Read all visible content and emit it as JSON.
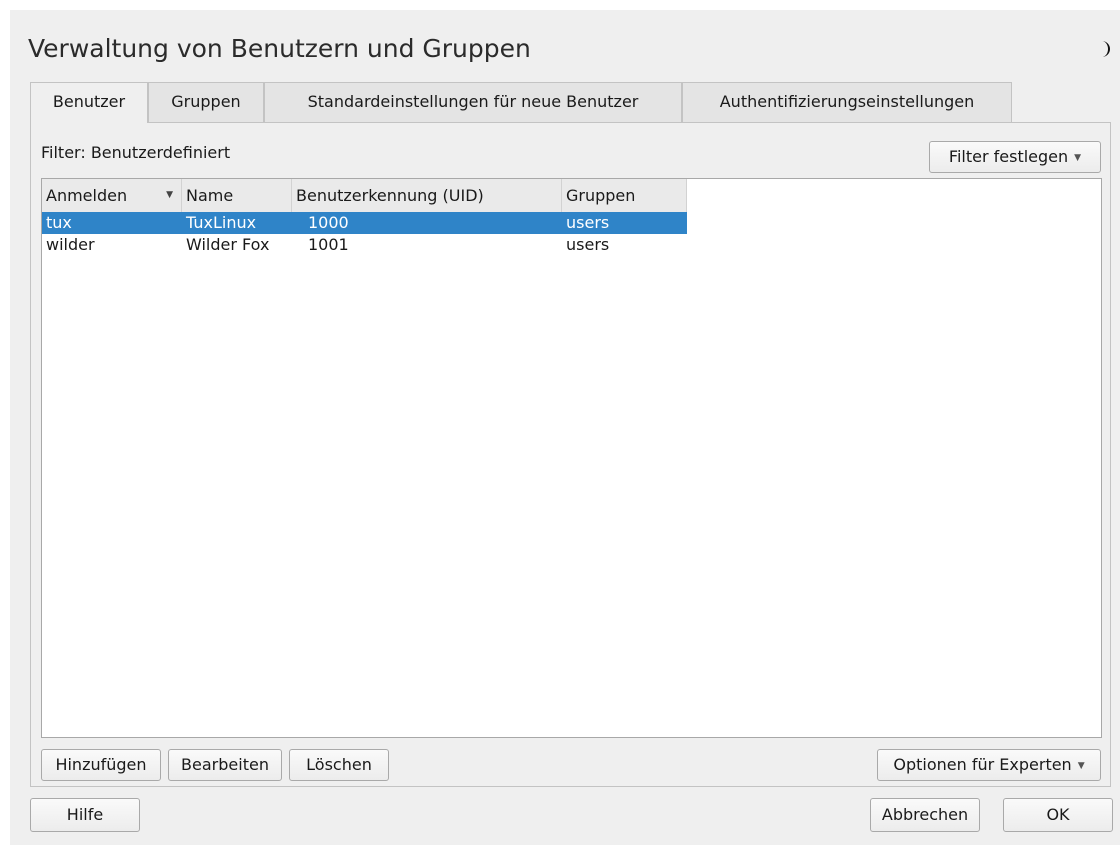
{
  "window": {
    "title": "Verwaltung von Benutzern und Gruppen",
    "title_icon": "moon-icon"
  },
  "tabs": [
    {
      "label": "Benutzer",
      "active": true
    },
    {
      "label": "Gruppen",
      "active": false
    },
    {
      "label": "Standardeinstellungen für neue Benutzer",
      "active": false
    },
    {
      "label": "Authentifizierungseinstellungen",
      "active": false
    }
  ],
  "filter": {
    "label": "Filter: Benutzerdefiniert",
    "button_label": "Filter festlegen"
  },
  "table": {
    "columns": [
      "Anmelden",
      "Name",
      "Benutzerkennung (UID)",
      "Gruppen"
    ],
    "sort_indicator": "sort-descending-icon",
    "rows": [
      {
        "login": "tux",
        "name": "TuxLinux",
        "uid": "1000",
        "groups": "users",
        "selected": true
      },
      {
        "login": "wilder",
        "name": "Wilder Fox",
        "uid": "1001",
        "groups": "users",
        "selected": false
      }
    ]
  },
  "actions": {
    "add": "Hinzufügen",
    "edit": "Bearbeiten",
    "delete": "Löschen",
    "expert_options": "Optionen für Experten"
  },
  "footer": {
    "help": "Hilfe",
    "cancel": "Abbrechen",
    "ok": "OK"
  },
  "colors": {
    "selection": "#2f84c8",
    "background": "#efefef"
  }
}
